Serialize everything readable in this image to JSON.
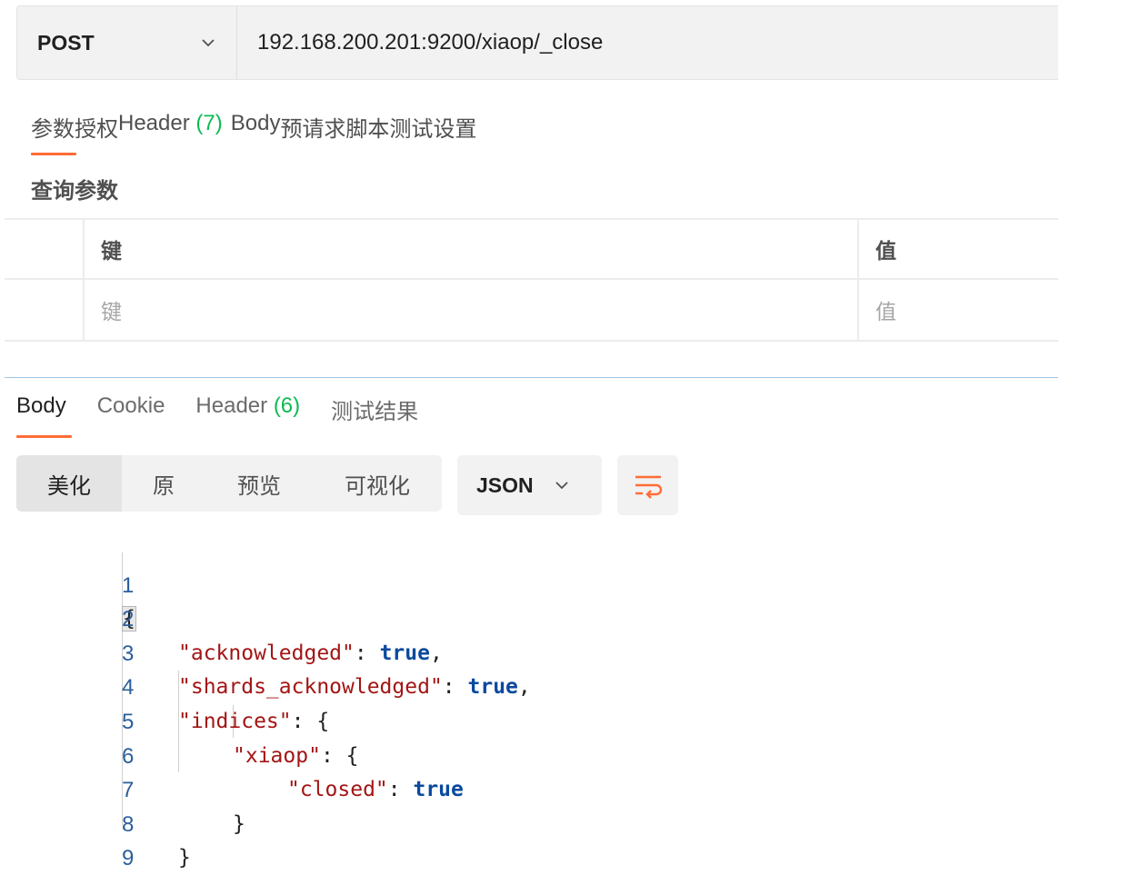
{
  "request": {
    "method": "POST",
    "url": "192.168.200.201:9200/xiaop/_close"
  },
  "request_tabs": [
    {
      "label": "参数"
    },
    {
      "label": "授权"
    },
    {
      "label": "Header",
      "count": "(7)"
    },
    {
      "label": "Body"
    },
    {
      "label": "预请求脚本"
    },
    {
      "label": "测试"
    },
    {
      "label": "设置"
    }
  ],
  "query_params": {
    "title": "查询参数",
    "header_key": "键",
    "header_value": "值",
    "placeholder_key": "键",
    "placeholder_value": "值"
  },
  "response_tabs": [
    {
      "label": "Body"
    },
    {
      "label": "Cookie"
    },
    {
      "label": "Header",
      "count": "(6)"
    },
    {
      "label": "测试结果"
    }
  ],
  "format_buttons": [
    "美化",
    "原",
    "预览",
    "可视化"
  ],
  "language": "JSON",
  "icons": {
    "method_dropdown": "chevron-down-icon",
    "language_dropdown": "chevron-down-icon",
    "wrap": "wrap-lines-icon"
  },
  "colors": {
    "accent": "#ff6c37",
    "count_green": "#0cbb52",
    "json_key": "#a31515",
    "json_keyword": "#0a4a9e"
  },
  "response_body": {
    "line_numbers": [
      "1",
      "2",
      "3",
      "4",
      "5",
      "6",
      "7",
      "8",
      "9"
    ],
    "lines": [
      "{",
      "\"acknowledged\": true,",
      "\"shards_acknowledged\": true,",
      "\"indices\": {",
      "\"xiaop\": {",
      "\"closed\": true",
      "}",
      "}",
      "}"
    ]
  }
}
